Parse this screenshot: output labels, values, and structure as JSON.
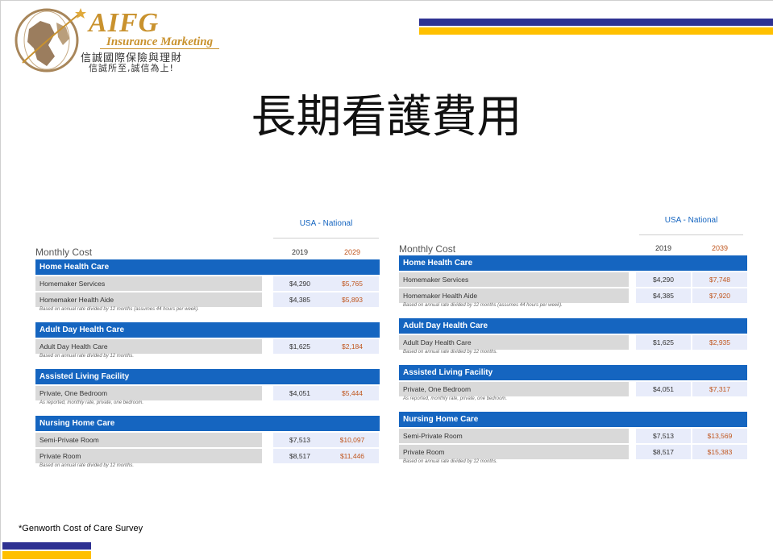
{
  "logo": {
    "brand": "AIFG",
    "subtitle": "Insurance Marketing",
    "tagline_cn": "信誠國際保險與理財",
    "motto_cn": "信誠所至,誠信為上!"
  },
  "title": "長期看護費用",
  "footnote": "*Genworth Cost of Care Survey",
  "colors": {
    "navy": "#2e3192",
    "gold": "#ffc000",
    "section_blue": "#1565c0",
    "future_orange": "#c0561e"
  },
  "tables": [
    {
      "region": "USA - National",
      "heading": "Monthly Cost",
      "year_base": "2019",
      "year_future": "2029",
      "sections": [
        {
          "name": "Home Health Care",
          "rows": [
            {
              "label": "Homemaker Services",
              "base": "$4,290",
              "future": "$5,765"
            },
            {
              "label": "Homemaker Health Aide",
              "base": "$4,385",
              "future": "$5,893"
            }
          ],
          "note": "Based on annual rate divided by 12 months (assumes 44 hours per week)."
        },
        {
          "name": "Adult Day Health Care",
          "rows": [
            {
              "label": "Adult Day Health Care",
              "base": "$1,625",
              "future": "$2,184"
            }
          ],
          "note": "Based on annual rate divided by 12 months."
        },
        {
          "name": "Assisted Living Facility",
          "rows": [
            {
              "label": "Private, One Bedroom",
              "base": "$4,051",
              "future": "$5,444"
            }
          ],
          "note": "As reported, monthly rate, private, one bedroom."
        },
        {
          "name": "Nursing Home Care",
          "rows": [
            {
              "label": "Semi-Private Room",
              "base": "$7,513",
              "future": "$10,097"
            },
            {
              "label": "Private Room",
              "base": "$8,517",
              "future": "$11,446"
            }
          ],
          "note": "Based on annual rate divided by 12 months."
        }
      ]
    },
    {
      "region": "USA - National",
      "heading": "Monthly Cost",
      "year_base": "2019",
      "year_future": "2039",
      "sections": [
        {
          "name": "Home Health Care",
          "rows": [
            {
              "label": "Homemaker Services",
              "base": "$4,290",
              "future": "$7,748"
            },
            {
              "label": "Homemaker Health Aide",
              "base": "$4,385",
              "future": "$7,920"
            }
          ],
          "note": "Based on annual rate divided by 12 months (assumes 44 hours per week)."
        },
        {
          "name": "Adult Day Health Care",
          "rows": [
            {
              "label": "Adult Day Health Care",
              "base": "$1,625",
              "future": "$2,935"
            }
          ],
          "note": "Based on annual rate divided by 12 months."
        },
        {
          "name": "Assisted Living Facility",
          "rows": [
            {
              "label": "Private, One Bedroom",
              "base": "$4,051",
              "future": "$7,317"
            }
          ],
          "note": "As reported, monthly rate, private, one bedroom."
        },
        {
          "name": "Nursing Home Care",
          "rows": [
            {
              "label": "Semi-Private Room",
              "base": "$7,513",
              "future": "$13,569"
            },
            {
              "label": "Private Room",
              "base": "$8,517",
              "future": "$15,383"
            }
          ],
          "note": "Based on annual rate divided by 12 months."
        }
      ]
    }
  ]
}
